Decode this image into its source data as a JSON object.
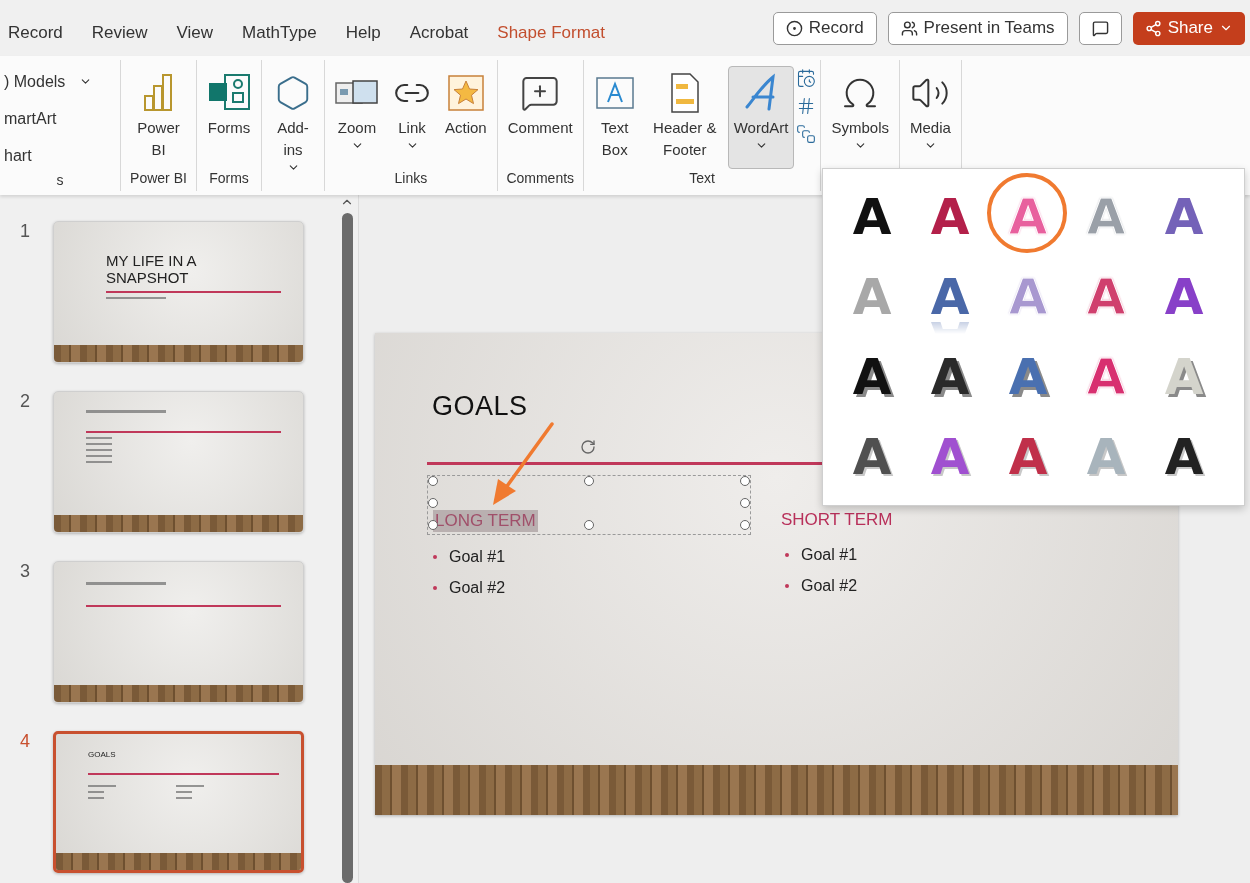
{
  "tabs": [
    {
      "label": "Record",
      "kind": "normal"
    },
    {
      "label": "Review",
      "kind": "normal"
    },
    {
      "label": "View",
      "kind": "normal"
    },
    {
      "label": "MathType",
      "kind": "normal"
    },
    {
      "label": "Help",
      "kind": "normal"
    },
    {
      "label": "Acrobat",
      "kind": "normal"
    },
    {
      "label": "Shape Format",
      "kind": "contextual"
    }
  ],
  "header_buttons": [
    {
      "kind": "record",
      "label": "Record"
    },
    {
      "kind": "teams",
      "label": "Present in Teams"
    },
    {
      "kind": "comments"
    },
    {
      "kind": "share",
      "label": "Share"
    }
  ],
  "ribbon_groups": [
    {
      "label": "s",
      "items": [
        {
          "kind": "list",
          "entries": [
            {
              "label": ") Models",
              "dropdown": true
            },
            {
              "label": "martArt",
              "dropdown": false
            },
            {
              "label": "hart",
              "dropdown": false
            }
          ]
        }
      ]
    },
    {
      "label": "Power BI",
      "items": [
        {
          "kind": "large",
          "label": "Power BI",
          "dropdown": false,
          "pressed": false
        }
      ]
    },
    {
      "label": "Forms",
      "items": [
        {
          "kind": "large",
          "label": "Forms",
          "dropdown": false,
          "pressed": false
        }
      ]
    },
    {
      "items": [
        {
          "kind": "large",
          "label": "Add-ins",
          "dropdown": true,
          "pressed": false
        }
      ]
    },
    {
      "label": "Links",
      "items": [
        {
          "kind": "large",
          "label": "Zoom",
          "dropdown": true,
          "pressed": false
        },
        {
          "kind": "large",
          "label": "Link",
          "dropdown": true,
          "pressed": false
        },
        {
          "kind": "large",
          "label": "Action",
          "dropdown": false,
          "pressed": false
        }
      ]
    },
    {
      "label": "Comments",
      "items": [
        {
          "kind": "large",
          "label": "Comment",
          "dropdown": false,
          "pressed": false
        }
      ]
    },
    {
      "label": "Text",
      "items": [
        {
          "kind": "large",
          "label": "Text Box",
          "dropdown": false,
          "pressed": false
        },
        {
          "kind": "large",
          "label": "Header & Footer",
          "dropdown": false,
          "pressed": false
        },
        {
          "kind": "large",
          "label": "WordArt",
          "dropdown": true,
          "pressed": true
        },
        {
          "kind": "stack"
        }
      ]
    },
    {
      "items": [
        {
          "kind": "large",
          "label": "Symbols",
          "dropdown": true,
          "pressed": false
        }
      ]
    },
    {
      "items": [
        {
          "kind": "large",
          "label": "Media",
          "dropdown": true,
          "pressed": false
        }
      ]
    }
  ],
  "slides": [
    {
      "number": "1",
      "selected": false,
      "kind": "title",
      "title": "MY LIFE IN A SNAPSHOT"
    },
    {
      "number": "2",
      "selected": false,
      "kind": "bullets"
    },
    {
      "number": "3",
      "selected": false,
      "kind": "heading"
    },
    {
      "number": "4",
      "selected": true,
      "kind": "columns",
      "title": "GOALS"
    }
  ],
  "slide": {
    "title": "GOALS",
    "annotation_arrow": true,
    "columns": [
      {
        "heading": "LONG TERM",
        "selected": true,
        "items": [
          "Goal #1",
          "Goal #2"
        ]
      },
      {
        "heading": "SHORT TERM",
        "selected": false,
        "items": [
          "Goal #1",
          "Goal #2"
        ]
      }
    ]
  },
  "wordart_gallery": [
    {
      "glyph": "A",
      "kind": "solid",
      "color": "#111111",
      "circled": false
    },
    {
      "glyph": "A",
      "kind": "solid",
      "color": "#b3204a",
      "circled": false
    },
    {
      "glyph": "A",
      "kind": "outline",
      "color": "#e8609e",
      "circled": true
    },
    {
      "glyph": "A",
      "kind": "outline",
      "color": "#9aa0a8",
      "circled": false
    },
    {
      "glyph": "A",
      "kind": "solid",
      "color": "#7462b8",
      "circled": false
    },
    {
      "glyph": "A",
      "kind": "solid",
      "color": "#a8a8a8",
      "circled": false
    },
    {
      "glyph": "A",
      "kind": "reflection",
      "color": "#4a68a8",
      "circled": false
    },
    {
      "glyph": "A",
      "kind": "outline",
      "color": "#a898d0",
      "circled": false
    },
    {
      "glyph": "A",
      "kind": "outline",
      "color": "#d0406e",
      "circled": false
    },
    {
      "glyph": "A",
      "kind": "solid",
      "color": "#8840c8",
      "circled": false
    },
    {
      "glyph": "A",
      "kind": "shadow",
      "color": "#111111",
      "circled": false
    },
    {
      "glyph": "A",
      "kind": "shadow",
      "color": "#2a2a2a",
      "circled": false
    },
    {
      "glyph": "A",
      "kind": "shadow",
      "color": "#4a70b0",
      "circled": false
    },
    {
      "glyph": "A",
      "kind": "outline",
      "color": "#d83070",
      "circled": false
    },
    {
      "glyph": "A",
      "kind": "shadow",
      "color": "#d4d4cc",
      "circled": false
    },
    {
      "glyph": "A",
      "kind": "pattern",
      "color": "#505050",
      "circled": false
    },
    {
      "glyph": "A",
      "kind": "pattern",
      "color": "#a050d0",
      "circled": false
    },
    {
      "glyph": "A",
      "kind": "pattern",
      "color": "#c0304a",
      "circled": false
    },
    {
      "glyph": "A",
      "kind": "pattern",
      "color": "#a8b4bc",
      "circled": false
    },
    {
      "glyph": "A",
      "kind": "pattern",
      "color": "#222222",
      "circled": false
    }
  ]
}
